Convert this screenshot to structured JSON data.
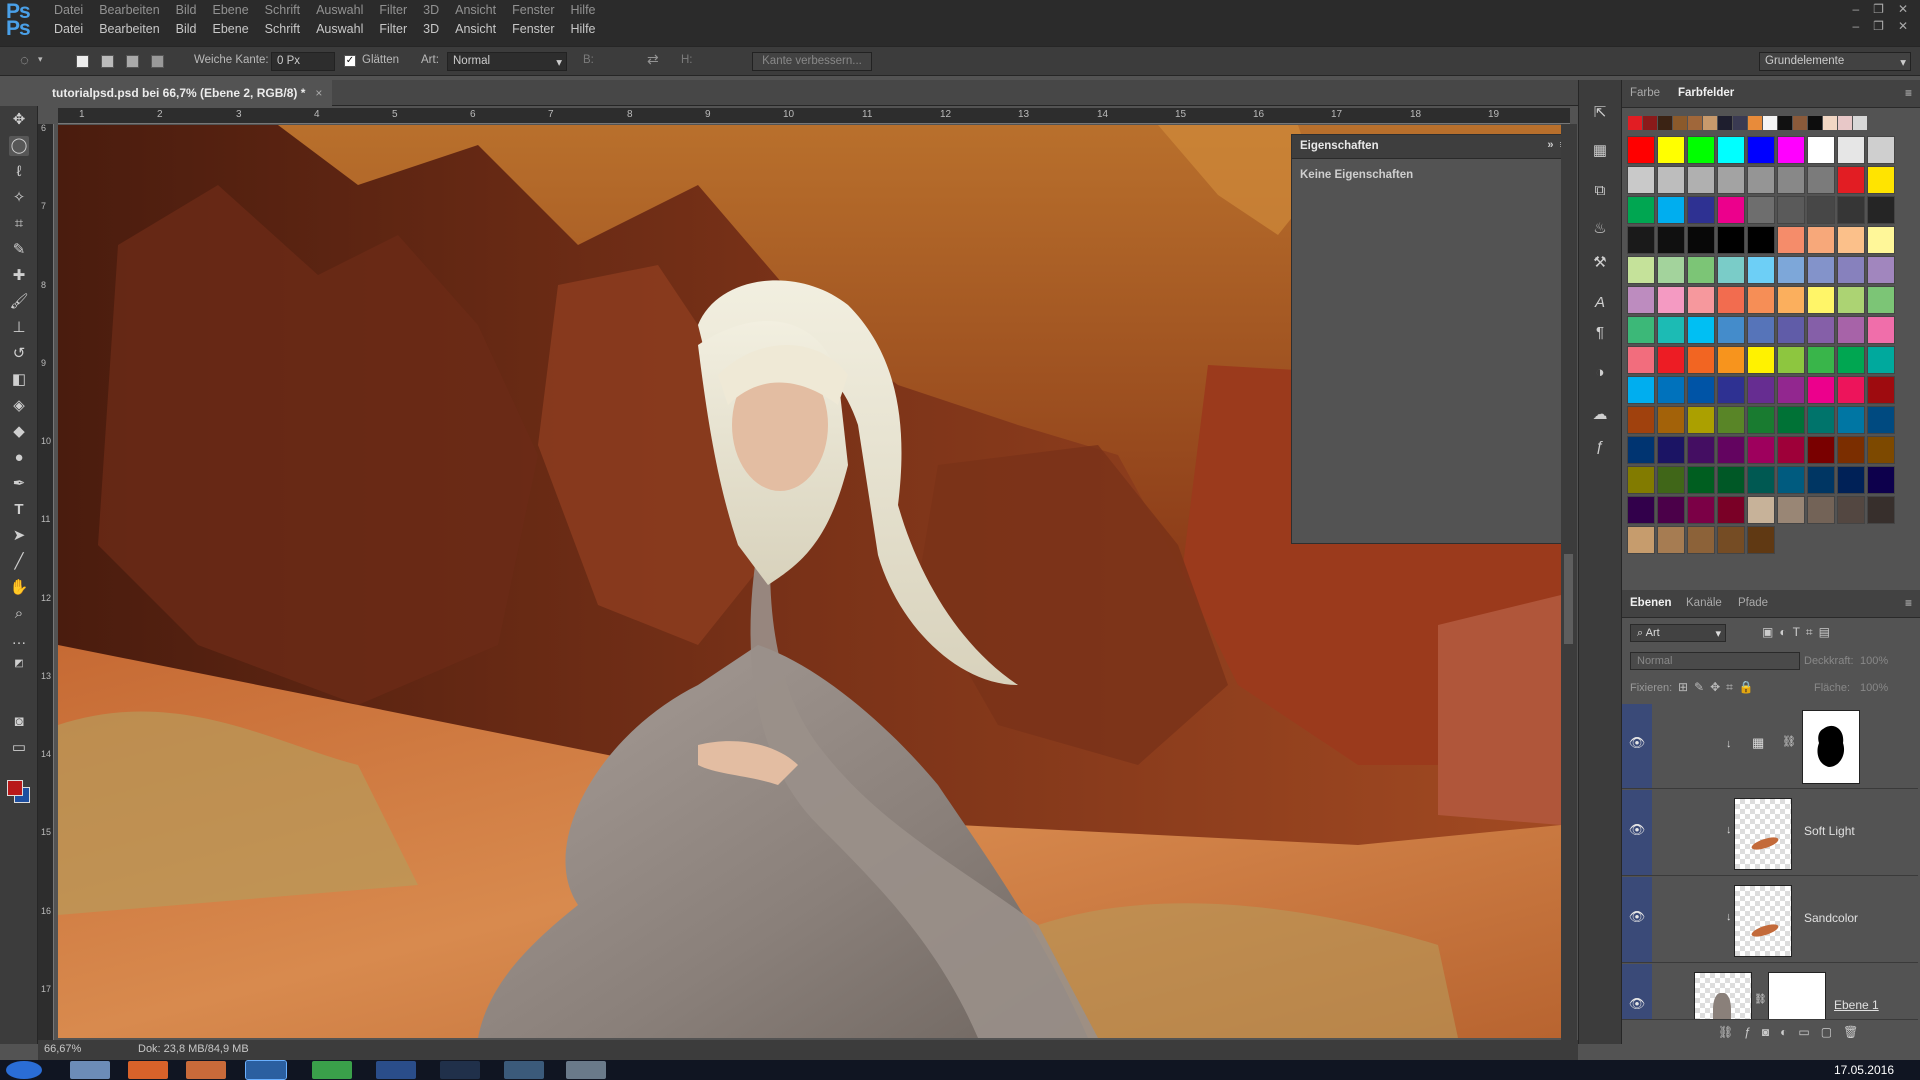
{
  "app": {
    "logo": "Ps"
  },
  "menu": [
    "Datei",
    "Bearbeiten",
    "Bild",
    "Ebene",
    "Schrift",
    "Auswahl",
    "Filter",
    "3D",
    "Ansicht",
    "Fenster",
    "Hilfe"
  ],
  "options": {
    "soft_edge_label": "Weiche Kante:",
    "soft_edge_value": "0 Px",
    "smooth_label": "Glätten",
    "style_label": "Art:",
    "style_value": "Normal",
    "width_label": "B:",
    "height_label": "H:",
    "refine_button": "Kante verbessern...",
    "workspace": "Grundelemente"
  },
  "document": {
    "tab_title": "tutorialpsd.psd bei 66,7% (Ebene 2, RGB/8) *",
    "tab_close": "×"
  },
  "ruler": {
    "h_ticks": [
      "1",
      "2",
      "3",
      "4",
      "5",
      "6",
      "7",
      "8",
      "9",
      "10",
      "11",
      "12",
      "13",
      "14",
      "15",
      "16",
      "17",
      "18",
      "19"
    ],
    "v_ticks": [
      "6",
      "7",
      "8",
      "9",
      "10",
      "11",
      "12",
      "13",
      "14",
      "15",
      "16",
      "17"
    ]
  },
  "properties": {
    "title": "Eigenschaften",
    "empty": "Keine Eigenschaften"
  },
  "color_panel": {
    "tab_color": "Farbe",
    "tab_swatches": "Farbfelder"
  },
  "layers_panel": {
    "tab_layers": "Ebenen",
    "tab_channels": "Kanäle",
    "tab_paths": "Pfade",
    "filter": "Art",
    "blend": "Normal",
    "opacity_label": "Deckkraft:",
    "opacity": "100%",
    "lock_label": "Fixieren:",
    "fill_label": "Fläche:",
    "fill": "100%",
    "layers": [
      {
        "name": ""
      },
      {
        "name": "Soft Light"
      },
      {
        "name": "Sandcolor"
      },
      {
        "name": "Ebene 1"
      }
    ]
  },
  "status": {
    "zoom": "66,67%",
    "doc": "Dok: 23,8 MB/84,9 MB"
  },
  "taskbar": {
    "date": "17.05.2016"
  },
  "swatch_colors": {
    "top_row": [
      "#e21d23",
      "#8a1a1a",
      "#3b2314",
      "#8b5a2b",
      "#a0673a",
      "#c89a6c",
      "#1e1e2e",
      "#3a3a52",
      "#e88b3a",
      "#f5f5f5",
      "#111111",
      "#8a5a3a",
      "#0d0d0d",
      "#f2d7c4",
      "#e8c8c8",
      "#d8d8d8"
    ],
    "grid": [
      [
        "#ff0000",
        "#ffff00",
        "#00ff00",
        "#00ffff",
        "#0000ff",
        "#ff00ff",
        "#ffffff",
        "#e6e6e6",
        "#cfcfcf"
      ],
      [
        "#c9c9c9",
        "#bdbdbd",
        "#b0b0b0",
        "#a3a3a3",
        "#959595",
        "#888888",
        "#7b7b7b",
        "#e21d23",
        "#ffe400"
      ],
      [
        "#00a651",
        "#00aeef",
        "#2e3192",
        "#ec008c",
        "#6e6e6e",
        "#5a5a5a",
        "#474747",
        "#363636",
        "#252525"
      ],
      [
        "#1a1a1a",
        "#101010",
        "#080808",
        "#000000",
        "#000000",
        "#f58c6a",
        "#f7a87a",
        "#fbc08a",
        "#fff799"
      ],
      [
        "#c5e29a",
        "#a3d39c",
        "#7cc576",
        "#7accc8",
        "#6dcff6",
        "#7da7d9",
        "#8393ca",
        "#8781bd",
        "#a186be"
      ],
      [
        "#bd8cbf",
        "#f49ac2",
        "#f6989d",
        "#f26c4f",
        "#f68e56",
        "#fbaf5d",
        "#fff568",
        "#acd373",
        "#7cc576"
      ],
      [
        "#3cb878",
        "#1cbbb4",
        "#00bff3",
        "#448ccb",
        "#5674b9",
        "#605ca8",
        "#855fa8",
        "#a763a8",
        "#f06eaa"
      ],
      [
        "#f26d7d",
        "#ed1c24",
        "#f26522",
        "#f7941d",
        "#fff200",
        "#8dc63f",
        "#39b54a",
        "#00a651",
        "#00a99d"
      ],
      [
        "#00aeef",
        "#0072bc",
        "#0054a6",
        "#2e3192",
        "#662d91",
        "#92278f",
        "#ec008c",
        "#ed145b",
        "#9e0b0f"
      ],
      [
        "#a0410d",
        "#a36209",
        "#aba000",
        "#598527",
        "#197b30",
        "#007236",
        "#00746b",
        "#0076a3",
        "#004a80"
      ],
      [
        "#003471",
        "#1b1464",
        "#440e62",
        "#630460",
        "#9e005d",
        "#9e0039",
        "#790000",
        "#7b2e00",
        "#7d4900"
      ],
      [
        "#827b00",
        "#406618",
        "#005e20",
        "#005826",
        "#005952",
        "#005b7f",
        "#003663",
        "#002157",
        "#0d004c"
      ],
      [
        "#32004b",
        "#4b0049",
        "#7b0046",
        "#7a0026",
        "#c7b299",
        "#998675",
        "#736357",
        "#534741",
        "#372f2c"
      ],
      [
        "#c69c6d",
        "#a67c52",
        "#8c6239",
        "#754c24",
        "#603913"
      ]
    ]
  },
  "palette": {
    "bg": "#535353",
    "panel_dark": "#3c3c3c",
    "menubar": "#2b2b2b",
    "fg_color": "#b8191a",
    "bg_color": "#1e4fa0",
    "layer_selected": "#3a4a78"
  }
}
